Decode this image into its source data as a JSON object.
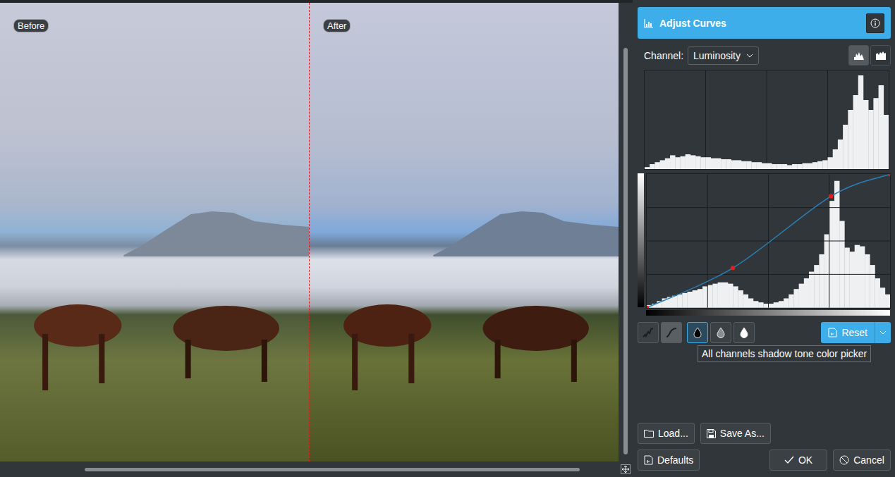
{
  "viewer": {
    "panes": [
      {
        "label": "Before"
      },
      {
        "label": "After"
      }
    ]
  },
  "tool": {
    "title": "Adjust Curves"
  },
  "channel": {
    "label": "Channel:",
    "value": "Luminosity"
  },
  "histogram_scale": [
    {
      "kind": "linear",
      "selected": true
    },
    {
      "kind": "logarithmic",
      "selected": false
    }
  ],
  "histogram": {
    "values": [
      0.02,
      0.05,
      0.07,
      0.09,
      0.11,
      0.14,
      0.12,
      0.13,
      0.15,
      0.14,
      0.13,
      0.12,
      0.12,
      0.11,
      0.11,
      0.1,
      0.1,
      0.09,
      0.09,
      0.08,
      0.08,
      0.07,
      0.07,
      0.06,
      0.06,
      0.05,
      0.05,
      0.05,
      0.04,
      0.05,
      0.05,
      0.06,
      0.06,
      0.07,
      0.08,
      0.09,
      0.12,
      0.2,
      0.3,
      0.45,
      0.6,
      0.75,
      0.95,
      0.7,
      0.6,
      0.72,
      0.85,
      0.55
    ]
  },
  "curve": {
    "points": [
      [
        0,
        0
      ],
      [
        0.354,
        0.298
      ],
      [
        0.757,
        0.835
      ],
      [
        1,
        1
      ]
    ],
    "histogram": [
      0.02,
      0.03,
      0.05,
      0.07,
      0.08,
      0.09,
      0.1,
      0.11,
      0.12,
      0.13,
      0.14,
      0.16,
      0.17,
      0.18,
      0.19,
      0.19,
      0.18,
      0.16,
      0.13,
      0.1,
      0.07,
      0.05,
      0.04,
      0.03,
      0.03,
      0.04,
      0.05,
      0.07,
      0.1,
      0.14,
      0.18,
      0.22,
      0.27,
      0.32,
      0.4,
      0.55,
      0.8,
      0.95,
      0.65,
      0.45,
      0.42,
      0.47,
      0.46,
      0.4,
      0.32,
      0.22,
      0.15,
      0.1
    ]
  },
  "curve_types": [
    {
      "kind": "free",
      "selected": false
    },
    {
      "kind": "smooth",
      "selected": true
    }
  ],
  "pickers": [
    {
      "kind": "shadow",
      "selected": true
    },
    {
      "kind": "midtone",
      "selected": false
    },
    {
      "kind": "highlight",
      "selected": false
    }
  ],
  "tooltip": "All channels shadow tone color picker",
  "reset_button": "Reset",
  "buttons": {
    "load": "Load...",
    "save": "Save As...",
    "defaults": "Defaults",
    "ok": "OK",
    "cancel": "Cancel"
  }
}
